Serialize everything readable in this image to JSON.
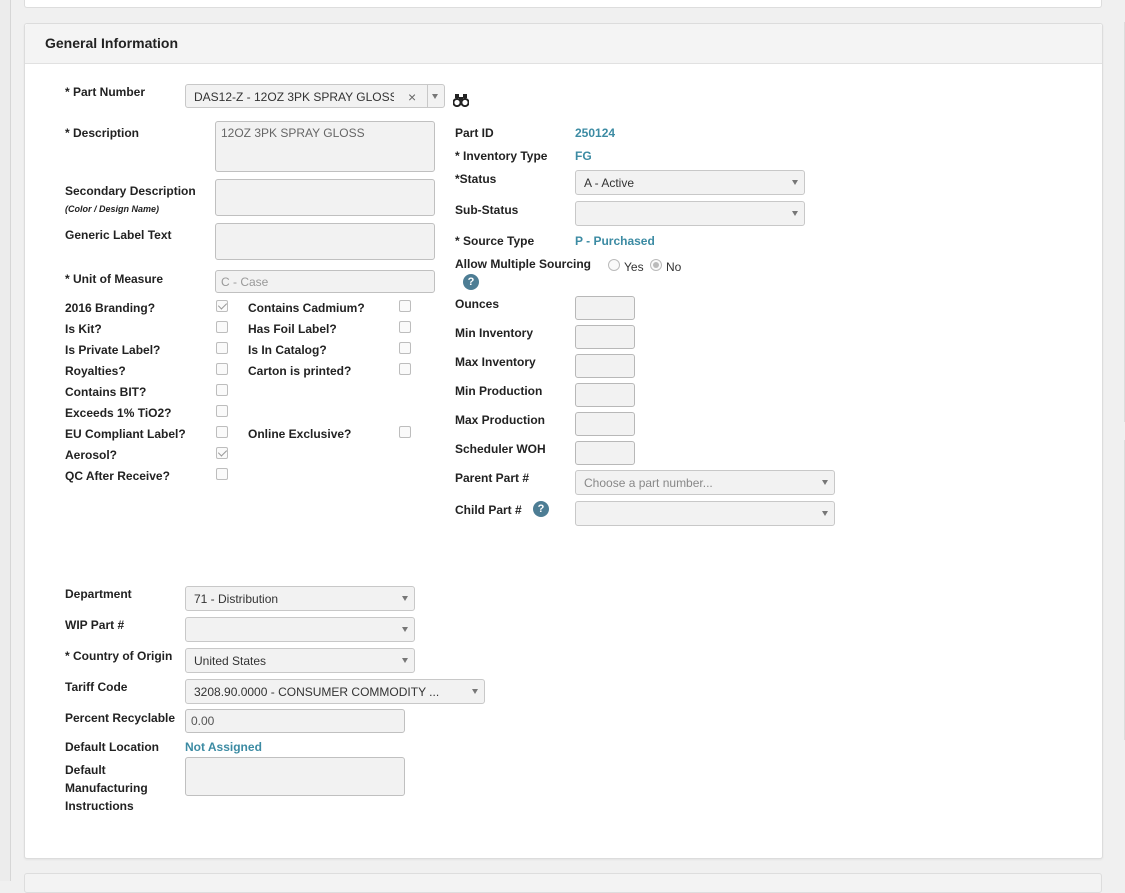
{
  "panel": {
    "title": "General Information"
  },
  "part_number": {
    "label": "* Part Number",
    "value": "DAS12-Z - 12OZ 3PK SPRAY GLOSS",
    "clear_symbol": "×",
    "lookup_icon": "binoculars-icon"
  },
  "description": {
    "label": "* Description",
    "value": "12OZ 3PK SPRAY GLOSS"
  },
  "secondary_description": {
    "label": "Secondary Description",
    "sublabel": "(Color / Design Name)",
    "value": ""
  },
  "generic_label_text": {
    "label": "Generic Label Text",
    "value": ""
  },
  "unit_of_measure": {
    "label": "* Unit of Measure",
    "placeholder": "C - Case"
  },
  "flags_left": [
    {
      "label": "2016 Branding?",
      "checked": true
    },
    {
      "label": "Is Kit?",
      "checked": false
    },
    {
      "label": "Is Private Label?",
      "checked": false
    },
    {
      "label": "Royalties?",
      "checked": false
    },
    {
      "label": "Contains BIT?",
      "checked": false
    },
    {
      "label": "Exceeds 1% TiO2?",
      "checked": false
    },
    {
      "label": "EU Compliant Label?",
      "checked": false
    },
    {
      "label": "Aerosol?",
      "checked": true
    },
    {
      "label": "QC After Receive?",
      "checked": false
    }
  ],
  "flags_right": [
    {
      "label": "Contains Cadmium?",
      "checked": false
    },
    {
      "label": "Has Foil Label?",
      "checked": false
    },
    {
      "label": "Is In Catalog?",
      "checked": false
    },
    {
      "label": "Carton is printed?",
      "checked": false
    },
    {
      "label": "Online Exclusive?",
      "checked": false
    }
  ],
  "part_id": {
    "label": "Part ID",
    "value": "250124"
  },
  "inventory_type": {
    "label": "* Inventory Type",
    "value": "FG"
  },
  "status": {
    "label": "*Status",
    "value": "A - Active"
  },
  "sub_status": {
    "label": "Sub-Status",
    "value": ""
  },
  "source_type": {
    "label": "* Source Type",
    "value": "P - Purchased"
  },
  "allow_multiple_sourcing": {
    "label": "Allow Multiple Sourcing",
    "yes_label": "Yes",
    "no_label": "No",
    "selected": "No",
    "help_icon": "question-icon",
    "help_symbol": "?"
  },
  "numeric_fields": [
    {
      "label": "Ounces",
      "value": ""
    },
    {
      "label": "Min Inventory",
      "value": ""
    },
    {
      "label": "Max Inventory",
      "value": ""
    },
    {
      "label": "Min Production",
      "value": ""
    },
    {
      "label": "Max Production",
      "value": ""
    },
    {
      "label": "Scheduler WOH",
      "value": ""
    }
  ],
  "parent_part": {
    "label": "Parent Part #",
    "placeholder": "Choose a part number..."
  },
  "child_part": {
    "label": "Child Part #",
    "value": "",
    "help_icon": "question-icon",
    "help_symbol": "?"
  },
  "department": {
    "label": "Department",
    "value": "71 - Distribution"
  },
  "wip_part": {
    "label": "WIP Part #",
    "value": ""
  },
  "country_of_origin": {
    "label": "* Country of Origin",
    "value": "United States"
  },
  "tariff_code": {
    "label": "Tariff Code",
    "value": "3208.90.0000 - CONSUMER COMMODITY ..."
  },
  "percent_recyclable": {
    "label": "Percent Recyclable",
    "value": "0.00"
  },
  "default_location": {
    "label": "Default Location",
    "value": "Not Assigned"
  },
  "default_instructions": {
    "label_lines": [
      "Default",
      "Manufacturing",
      "Instructions"
    ],
    "value": ""
  },
  "colors": {
    "accent_value": "#3c8ba3",
    "help_badge": "#4d7d94"
  }
}
